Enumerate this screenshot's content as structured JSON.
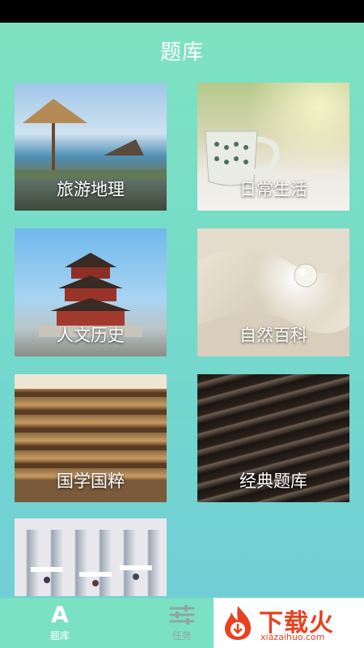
{
  "header": {
    "title": "题库"
  },
  "tiles": [
    {
      "label": "旅游地理",
      "art": "travel-photo"
    },
    {
      "label": "日常生活",
      "art": "daily-life-photo"
    },
    {
      "label": "人文历史",
      "art": "history-photo"
    },
    {
      "label": "自然百科",
      "art": "nature-photo"
    },
    {
      "label": "国学国粹",
      "art": "guoxue-photo"
    },
    {
      "label": "经典题库",
      "art": "classic-photo"
    },
    {
      "label": "",
      "art": "library-photo"
    }
  ],
  "tabbar": {
    "items": [
      {
        "label": "题库",
        "icon": "A",
        "active": true
      },
      {
        "label": "任务",
        "icon": "sliders-icon",
        "active": false
      }
    ]
  },
  "watermark": {
    "brand": "下载火",
    "domain": "xiazaihuo.com"
  },
  "colors": {
    "bg_top": "#7fe3c0",
    "bg_bottom": "#6fcdd8",
    "tabbar": "#7ae1c3",
    "watermark_red": "#e8411f"
  }
}
